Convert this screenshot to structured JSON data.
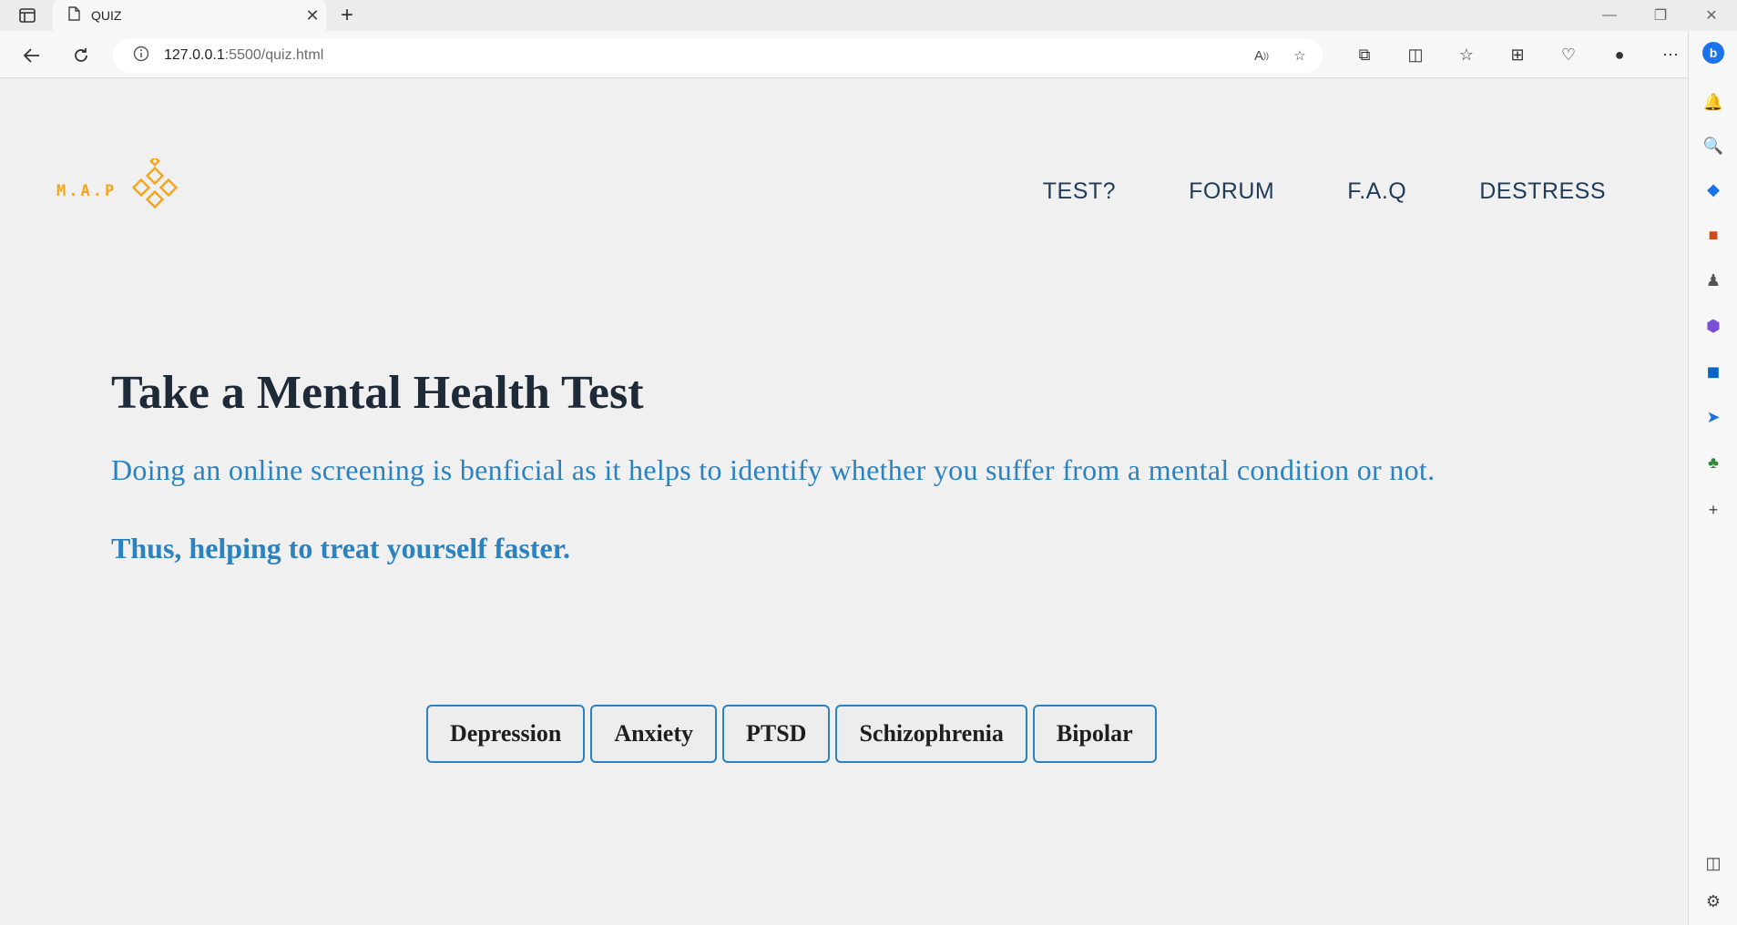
{
  "browser": {
    "tab_title": "QUIZ",
    "new_tab_symbol": "+",
    "address_host": "127.0.0.1",
    "address_rest": ":5500/quiz.html",
    "controls": [
      "—",
      "❐",
      "✕"
    ]
  },
  "site": {
    "logo_text": "M.A.P",
    "logo_color": "#f2a51a",
    "nav": [
      "TEST?",
      "FORUM",
      "F.A.Q",
      "DESTRESS"
    ]
  },
  "main": {
    "heading": "Take a Mental Health Test",
    "description": "Doing an online screening is benficial as it helps to identify whether you suffer from a mental condition or not.",
    "emphasis": "Thus, helping to treat yourself faster.",
    "accent_color": "#2b82c0"
  },
  "tests": [
    "Depression",
    "Anxiety",
    "PTSD",
    "Schizophrenia",
    "Bipolar"
  ]
}
